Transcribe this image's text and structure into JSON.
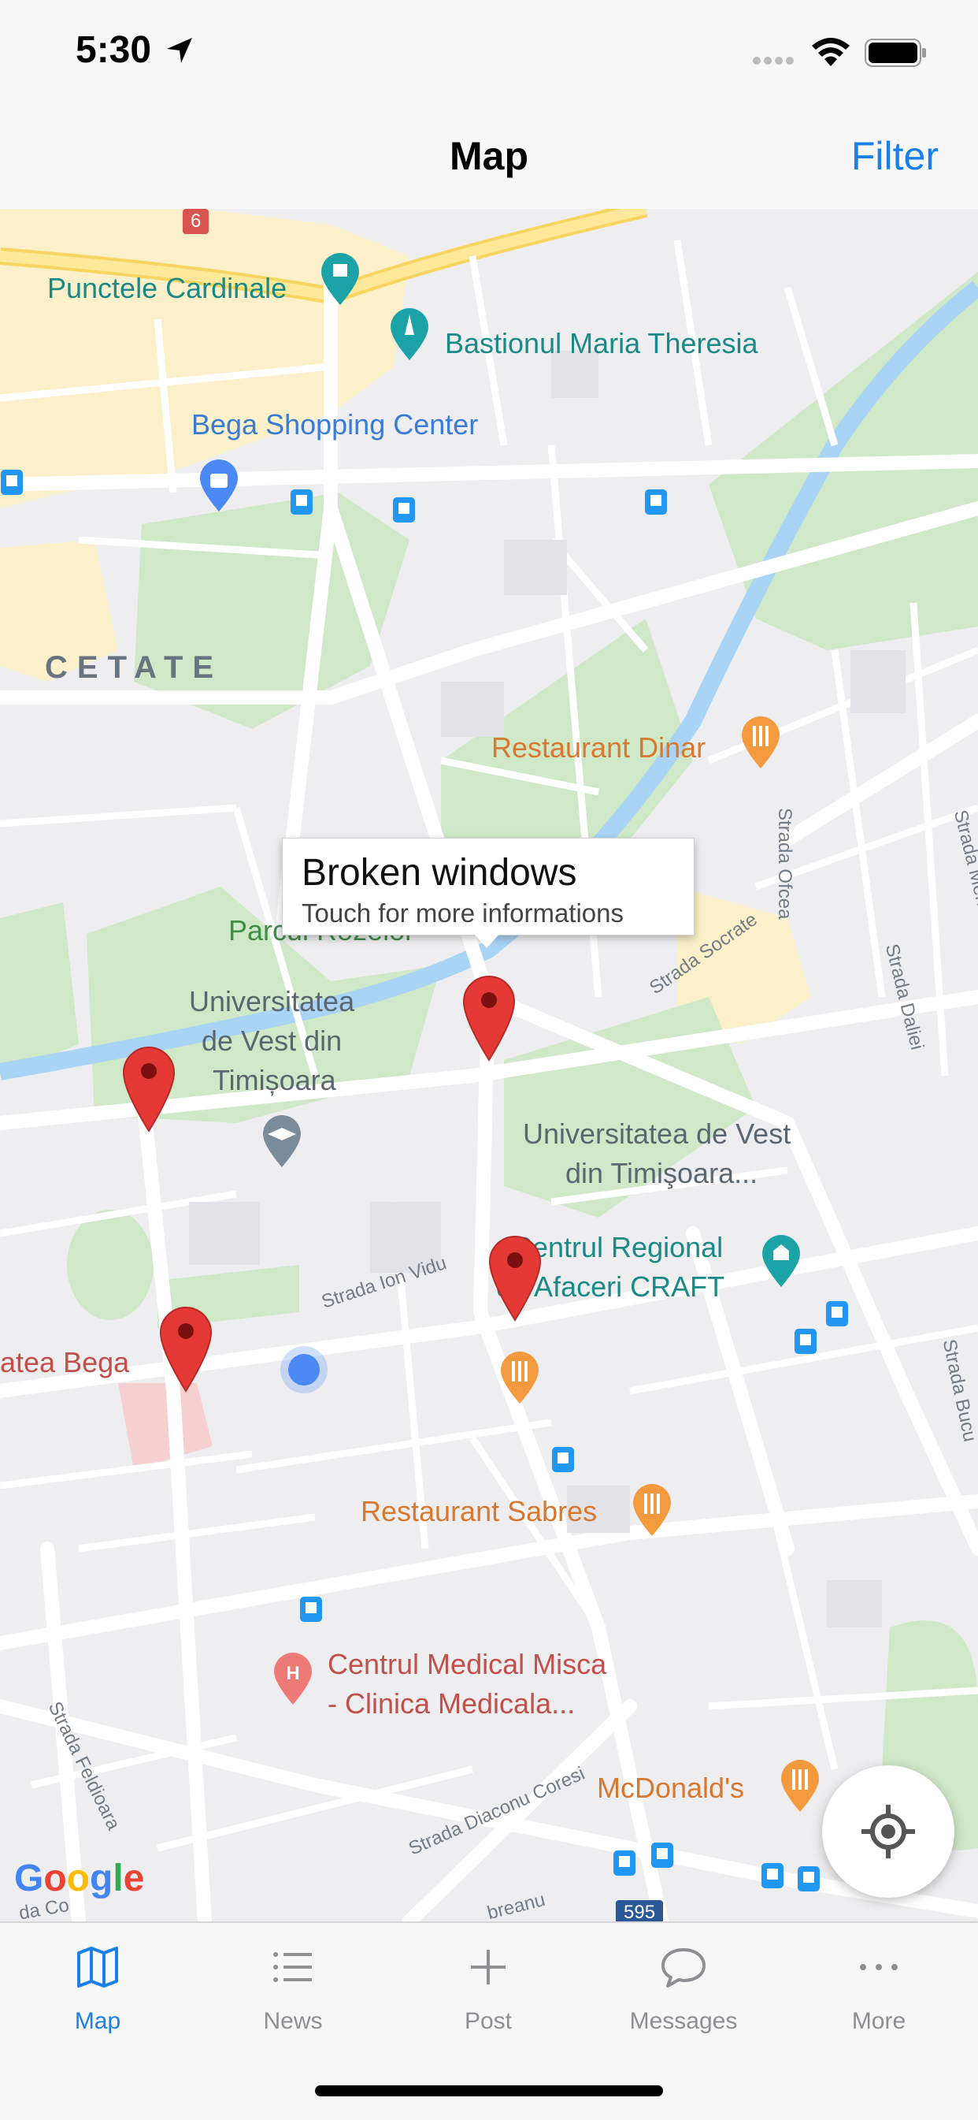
{
  "status_bar": {
    "time": "5:30"
  },
  "nav": {
    "title": "Map",
    "filter_label": "Filter"
  },
  "map": {
    "labels": {
      "punctele": "Punctele Cardinale",
      "bastion": "Bastionul Maria Theresia",
      "bega_center": "Bega Shopping Center",
      "cetate": "CETATE",
      "dinar": "Restaurant Dinar",
      "parc": "Parcul Rozelor",
      "univ1_l1": "Universitatea",
      "univ1_l2": "de Vest din",
      "univ1_l3": "Timișoara",
      "univ2_l1": "Universitatea de Vest",
      "univ2_l2": "din Timişoara...",
      "craft_l1": "Centrul Regional",
      "craft_l2": "de Afaceri CRAFT",
      "bega": "atea Bega",
      "sabres": "Restaurant Sabres",
      "misca_l1": "Centrul Medical Misca",
      "misca_l2": "- Clinica Medicala...",
      "mcd": "McDonald's",
      "ofcea": "Strada Ofcea",
      "mehadia": "Strada Mehadi",
      "daliei": "Strada Daliei",
      "socrate": "Strada Socrate",
      "ion_vidu": "Strada Ion Vidu",
      "feldioara": "Strada Feldioara",
      "diacon": "Strada Diaconu Coresi",
      "bucu": "Strada Bucu",
      "breanu": "breanu",
      "coo": "da Co",
      "route6": "6",
      "route595": "595"
    },
    "callout": {
      "title": "Broken windows",
      "subtitle": "Touch for more informations"
    },
    "google": "Google"
  },
  "tabs": [
    {
      "label": "Map",
      "icon": "map-icon",
      "active": true
    },
    {
      "label": "News",
      "icon": "list-icon",
      "active": false
    },
    {
      "label": "Post",
      "icon": "plus-icon",
      "active": false
    },
    {
      "label": "Messages",
      "icon": "chat-bubble-icon",
      "active": false
    },
    {
      "label": "More",
      "icon": "ellipsis-icon",
      "active": false
    }
  ],
  "colors": {
    "accent": "#1a7fe8",
    "pin_red": "#e53935",
    "park_green": "#c8e6c0",
    "river_blue": "#a8d4f5",
    "road_white": "#ffffff"
  }
}
